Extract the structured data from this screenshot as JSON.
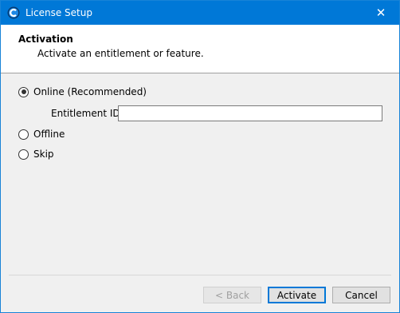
{
  "window": {
    "title": "License Setup",
    "close_symbol": "✕",
    "app_icon": "app-logo-icon"
  },
  "header": {
    "title": "Activation",
    "subtitle": "Activate an entitlement or feature."
  },
  "options": {
    "online": {
      "label": "Online (Recommended)",
      "selected": true
    },
    "offline": {
      "label": "Offline",
      "selected": false
    },
    "skip": {
      "label": "Skip",
      "selected": false
    }
  },
  "entitlement": {
    "label": "Entitlement ID:",
    "value": ""
  },
  "buttons": {
    "back": "< Back",
    "activate": "Activate",
    "cancel": "Cancel"
  },
  "colors": {
    "titlebar": "#0078d7",
    "default_button_border": "#0078d7"
  }
}
